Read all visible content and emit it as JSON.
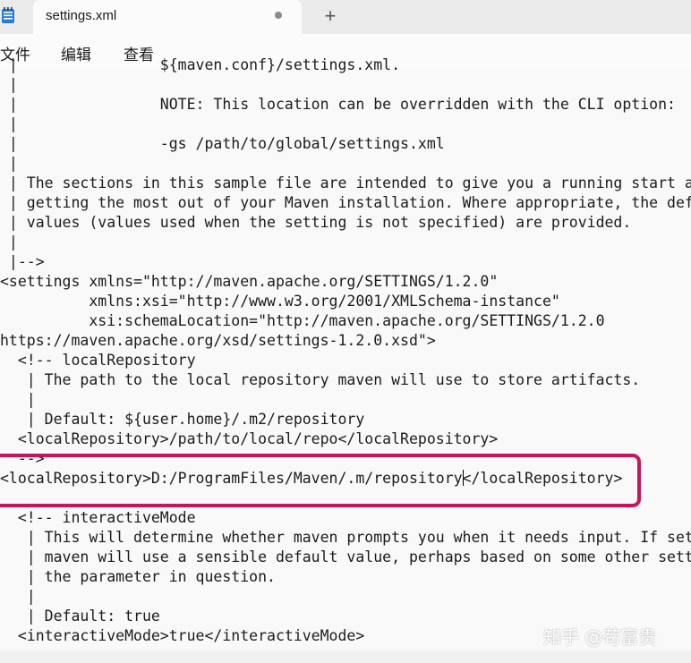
{
  "tab": {
    "title": "settings.xml"
  },
  "menu": [
    "文件",
    "编辑",
    "查看"
  ],
  "lines": [
    " |                ${maven.conf}/settings.xml.",
    " |",
    " |                NOTE: This location can be overridden with the CLI option:",
    " |",
    " |                -gs /path/to/global/settings.xml",
    " |",
    " | The sections in this sample file are intended to give you a running start at",
    " | getting the most out of your Maven installation. Where appropriate, the default",
    " | values (values used when the setting is not specified) are provided.",
    " |",
    " |-->",
    "<settings xmlns=\"http://maven.apache.org/SETTINGS/1.2.0\"",
    "          xmlns:xsi=\"http://www.w3.org/2001/XMLSchema-instance\"",
    "          xsi:schemaLocation=\"http://maven.apache.org/SETTINGS/1.2.0",
    "https://maven.apache.org/xsd/settings-1.2.0.xsd\">",
    "  <!-- localRepository",
    "   | The path to the local repository maven will use to store artifacts.",
    "   |",
    "   | Default: ${user.home}/.m2/repository",
    "  <localRepository>/path/to/local/repo</localRepository>",
    "  -->",
    "<localRepository>D:/ProgramFiles/Maven/.m/repository</localRepository>",
    "",
    "  <!-- interactiveMode",
    "   | This will determine whether maven prompts you when it needs input. If set to false,",
    "   | maven will use a sensible default value, perhaps based on some other setting, for",
    "   | the parameter in question.",
    "   |",
    "   | Default: true",
    "  <interactiveMode>true</interactiveMode>"
  ],
  "caret_line": 21,
  "caret_text_before": "<localRepository>D:/ProgramFiles/Maven/.m/repository",
  "caret_text_after": "</localRepository>",
  "highlight_color": "#c2185b",
  "watermark": "知乎 @苟富贵"
}
